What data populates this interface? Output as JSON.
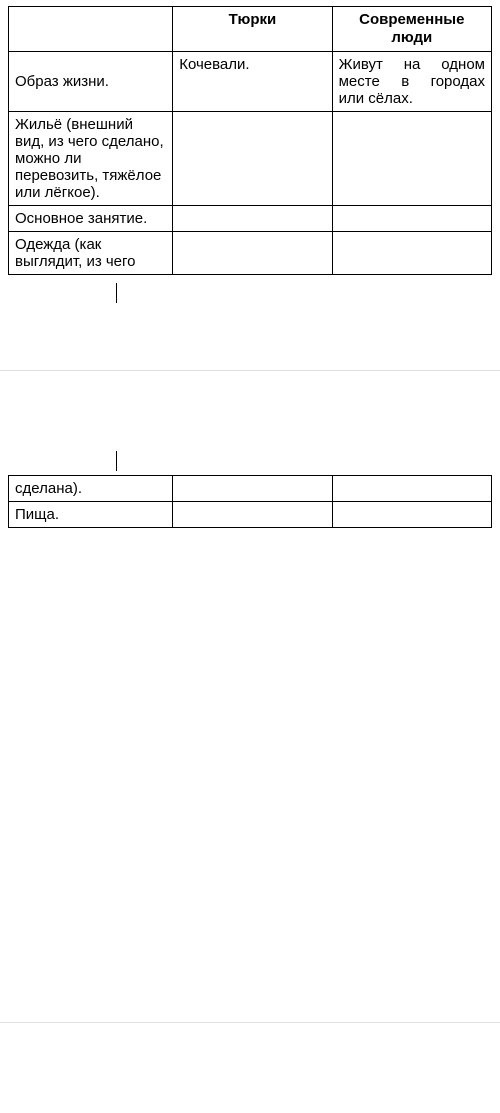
{
  "headers": {
    "col1": "",
    "col2": "Тюрки",
    "col3_line1": "Современные",
    "col3_line2": "люди"
  },
  "rows": [
    {
      "label": "Образ жизни.",
      "col2": "Кочевали.",
      "col3_j1": "Живут на одном",
      "col3_j2": "месте в городах",
      "col3_last": "или сёлах."
    },
    {
      "label": "Жильё (внешний вид, из чего сделано, можно ли перевозить, тяжёлое или лёгкое).",
      "col2": "",
      "col3": ""
    },
    {
      "label": "Основное занятие.",
      "col2": "",
      "col3": ""
    },
    {
      "label": "Одежда (как выглядит, из чего",
      "col2": "",
      "col3": ""
    }
  ],
  "fragment_rows": [
    {
      "label": "сделана).",
      "col2": "",
      "col3": ""
    },
    {
      "label": "Пища.",
      "col2": "",
      "col3": ""
    }
  ]
}
